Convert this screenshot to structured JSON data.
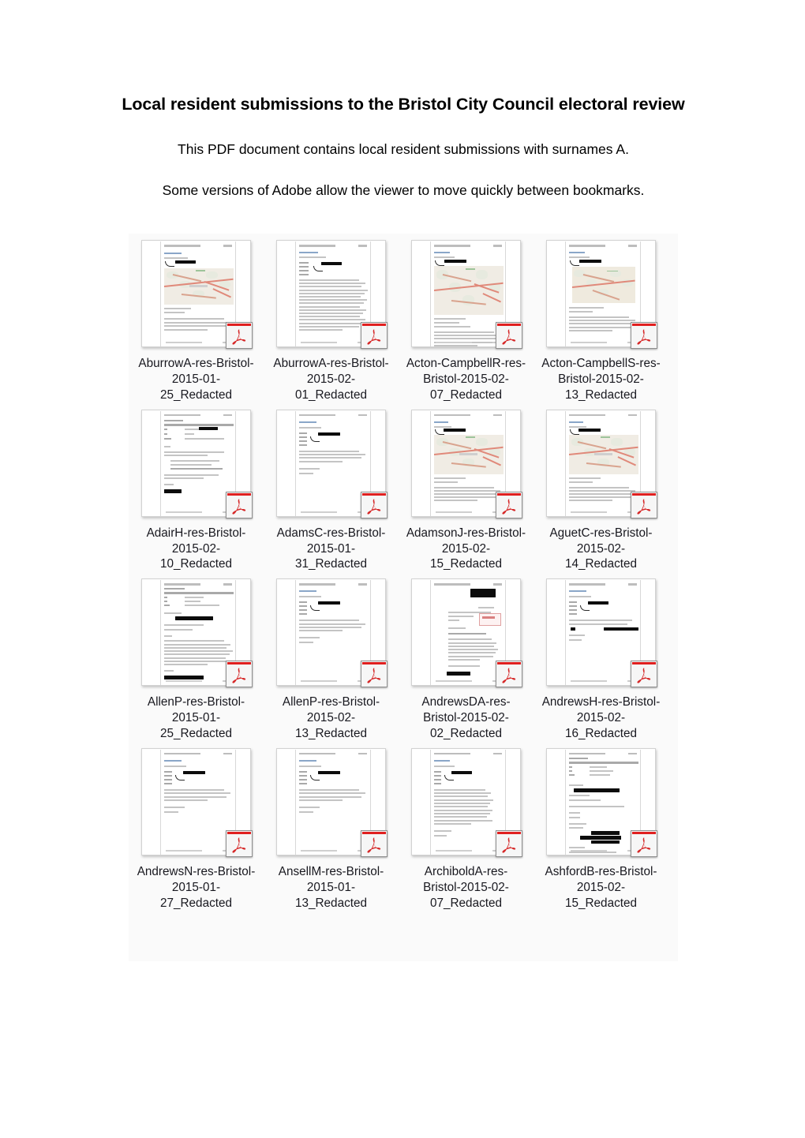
{
  "document": {
    "title": "Local resident submissions to the Bristol City Council electoral review",
    "paragraph_1": "This PDF document contains local resident submissions with surnames A.",
    "paragraph_2": "Some versions of Adobe allow the viewer to move quickly between bookmarks."
  },
  "colors": {
    "pdf_accent": "#e02020",
    "grid_background": "#fafafa",
    "label_text": "#18181f",
    "page_background": "#ffffff"
  },
  "file_grid": {
    "columns": 4,
    "rows": 4,
    "icon_type": "pdf-file-icon",
    "files": [
      {
        "name": "AburrowA-res-Bristol-2015-01-25_Redacted",
        "thumb": "map"
      },
      {
        "name": "AburrowA-res-Bristol-2015-02-01_Redacted",
        "thumb": "letter-dense"
      },
      {
        "name": "Acton-CampbellR-res-Bristol-2015-02-07_Redacted",
        "thumb": "map-large"
      },
      {
        "name": "Acton-CampbellS-res-Bristol-2015-02-13_Redacted",
        "thumb": "map-os"
      },
      {
        "name": "AdairH-res-Bristol-2015-02-10_Redacted",
        "thumb": "email-form"
      },
      {
        "name": "AdamsC-res-Bristol-2015-01-31_Redacted",
        "thumb": "email-short"
      },
      {
        "name": "AdamsonJ-res-Bristol-2015-02-15_Redacted",
        "thumb": "map-roads"
      },
      {
        "name": "AguetC-res-Bristol-2015-02-14_Redacted",
        "thumb": "map-roads"
      },
      {
        "name": "AllenP-res-Bristol-2015-01-25_Redacted",
        "thumb": "letter-redacted"
      },
      {
        "name": "AllenP-res-Bristol-2015-02-13_Redacted",
        "thumb": "email-short"
      },
      {
        "name": "AndrewsDA-res-Bristol-2015-02-02_Redacted",
        "thumb": "letter-stamp"
      },
      {
        "name": "AndrewsH-res-Bristol-2015-02-16_Redacted",
        "thumb": "email-redacted"
      },
      {
        "name": "AndrewsN-res-Bristol-2015-01-27_Redacted",
        "thumb": "email-short"
      },
      {
        "name": "AnsellM-res-Bristol-2015-01-13_Redacted",
        "thumb": "email-short"
      },
      {
        "name": "ArchiboldA-res-Bristol-2015-02-07_Redacted",
        "thumb": "email-body"
      },
      {
        "name": "AshfordB-res-Bristol-2015-02-15_Redacted",
        "thumb": "email-form-redacted"
      }
    ]
  }
}
